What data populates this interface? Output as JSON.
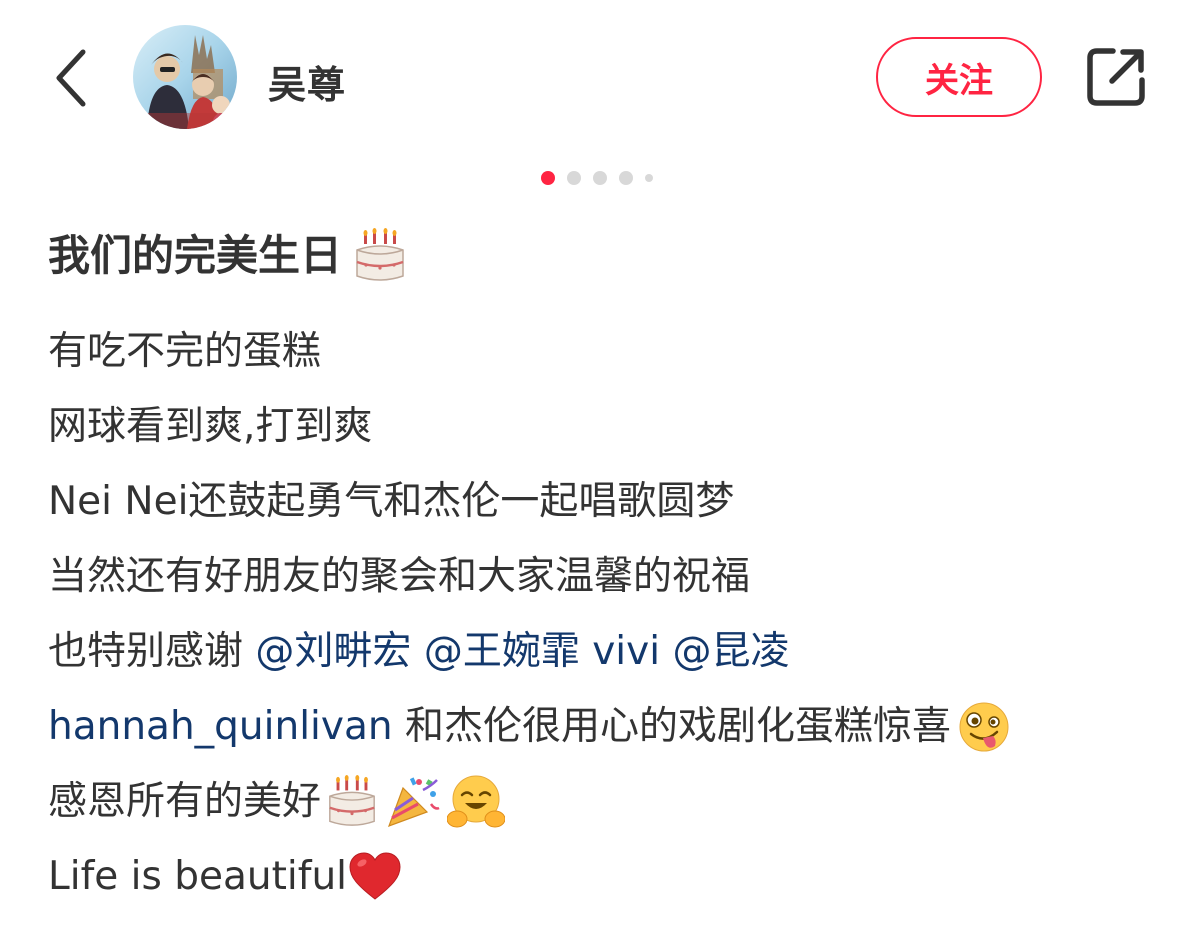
{
  "header": {
    "author_name": "吴尊",
    "follow_label": "关注",
    "icons": {
      "back": "back-chevron-icon",
      "share": "share-icon",
      "avatar": "user-avatar-photo"
    }
  },
  "carousel": {
    "total_dots": 5,
    "active_index": 0
  },
  "note": {
    "title": "我们的完美生日",
    "title_emoji": "birthday-cake",
    "lines": {
      "l1": "有吃不完的蛋糕",
      "l2": "网球看到爽,打到爽",
      "l3": "Nei Nei还鼓起勇气和杰伦一起唱歌圆梦",
      "l4": "当然还有好朋友的聚会和大家温馨的祝福",
      "l5_prefix": "也特别感谢 ",
      "l5_mention1": "@刘畊宏",
      "l5_mention2": "@王婉霏 vivi",
      "l5_mention3": "@昆凌",
      "l6_mention": "hannah_quinlivan",
      "l6_text": " 和杰伦很用心的戏剧化蛋糕惊喜",
      "l6_emoji": "zany-face",
      "l7_text": "感恩所有的美好",
      "l7_emojis": [
        "birthday-cake",
        "party-popper",
        "hugging-face"
      ],
      "l8_text": "Life is beautiful",
      "l8_emoji": "red-heart"
    }
  },
  "colors": {
    "accent": "#ff2442",
    "mention": "#13386c",
    "text": "#333333"
  }
}
